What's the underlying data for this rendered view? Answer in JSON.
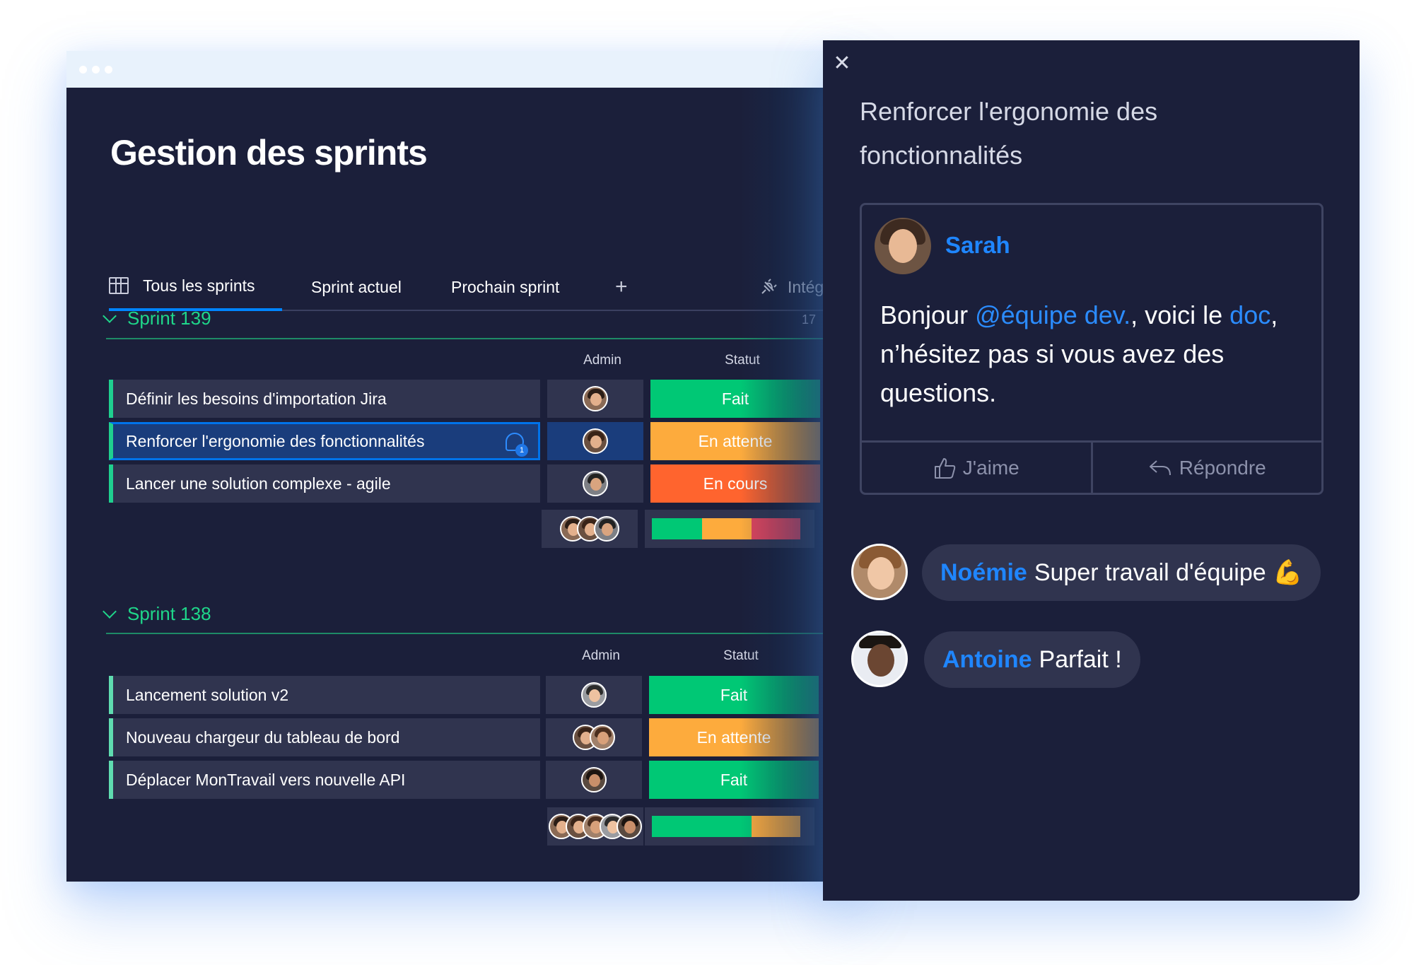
{
  "board": {
    "title": "Gestion des sprints",
    "tabs": [
      {
        "label": "Tous les sprints"
      },
      {
        "label": "Sprint actuel"
      },
      {
        "label": "Prochain sprint"
      },
      {
        "label": "+"
      },
      {
        "label": "Intég"
      }
    ]
  },
  "groups": [
    {
      "title": "Sprint 139",
      "count": "17",
      "col_admin": "Admin",
      "col_status": "Statut",
      "rows": [
        {
          "name": "Définir les besoins d'importation Jira",
          "status": "Fait",
          "status_color": "#00c875"
        },
        {
          "name": "Renforcer l'ergonomie des fonctionnalités",
          "status": "En attente",
          "status_color": "#fdab3d",
          "comments": "1"
        },
        {
          "name": "Lancer une solution complexe - agile",
          "status": "En cours",
          "status_color": "#ff642e"
        }
      ],
      "progress": [
        {
          "label": "Fait",
          "fraction": 0.34,
          "color": "#00c875"
        },
        {
          "label": "En attente",
          "fraction": 0.33,
          "color": "#fdab3d"
        },
        {
          "label": "En cours",
          "fraction": 0.33,
          "color": "#e2445c"
        }
      ]
    },
    {
      "title": "Sprint 138",
      "col_admin": "Admin",
      "col_status": "Statut",
      "rows": [
        {
          "name": "Lancement solution v2",
          "status": "Fait",
          "status_color": "#00c875"
        },
        {
          "name": "Nouveau chargeur du tableau de bord",
          "status": "En attente",
          "status_color": "#fdab3d"
        },
        {
          "name": "Déplacer MonTravail vers nouvelle API",
          "status": "Fait",
          "status_color": "#00c875"
        }
      ],
      "progress": [
        {
          "label": "Fait",
          "fraction": 0.67,
          "color": "#00c875"
        },
        {
          "label": "En attente",
          "fraction": 0.33,
          "color": "#fdab3d"
        }
      ]
    }
  ],
  "panel": {
    "close_symbol": "✕",
    "title": "Renforcer l'ergonomie des fonctionnalités",
    "update": {
      "author": "Sarah",
      "text_1": "Bonjour ",
      "mention": "@équipe dev.",
      "text_2": ", voici le ",
      "link": "doc",
      "text_3": ", n’hésitez pas si vous avez des questions.",
      "like_label": "J'aime",
      "reply_label": "Répondre"
    },
    "replies": [
      {
        "author": "Noémie",
        "text": "Super travail d'équipe 💪"
      },
      {
        "author": "Antoine",
        "text": "Parfait !"
      }
    ]
  },
  "colors": {
    "background": "#1b1f3a",
    "accent": "#0085ff",
    "group_green": "#1fd68a"
  }
}
